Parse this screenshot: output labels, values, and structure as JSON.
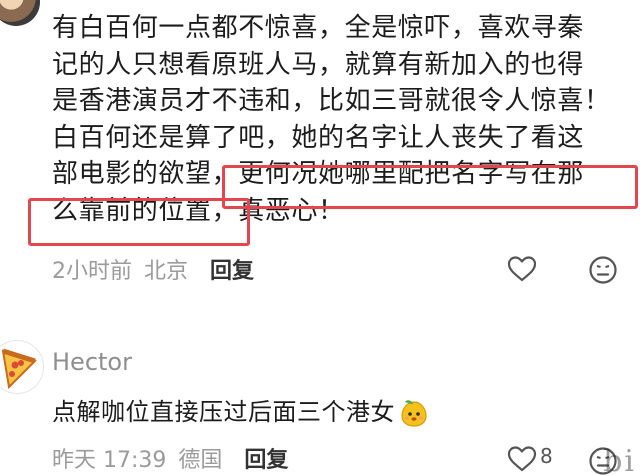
{
  "comment1": {
    "lines": [
      "有白百何一点都不惊喜，全是惊吓，喜欢寻秦",
      "记的人只想看原班人马，就算有新加入的也得",
      "是香港演员才不违和，比如三哥就很令人惊喜！",
      "白百何还是算了吧，她的名字让人丧失了看这",
      "部电影的欲望，更何况她哪里配把名字写在那",
      "么靠前的位置，真恶心！"
    ],
    "time": "2小时前",
    "location": "北京",
    "reply_label": "回复",
    "icons": {
      "like": "heart-icon",
      "dislike": "frown-emoji-icon",
      "avatar": "user-avatar"
    },
    "highlight_color": "#e2474f"
  },
  "comment2": {
    "username": "Hector",
    "text": "点解咖位直接压过后面三个港女",
    "emoji": "mango-emoji",
    "time": "昨天 17:39",
    "location": "德国",
    "reply_label": "回复",
    "like_count": "8",
    "icons": {
      "like": "heart-icon",
      "dislike": "frown-emoji-icon",
      "avatar": "pizza-avatar"
    }
  },
  "watermark": "bi"
}
